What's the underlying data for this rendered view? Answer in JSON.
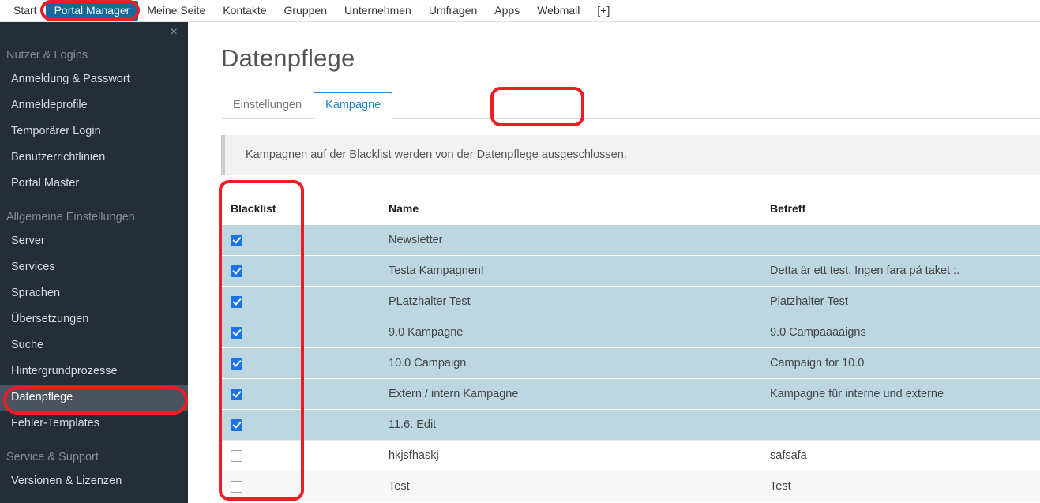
{
  "topnav": {
    "items": [
      {
        "label": "Start",
        "active": false
      },
      {
        "label": "Portal Manager",
        "active": true
      },
      {
        "label": "Meine Seite",
        "active": false
      },
      {
        "label": "Kontakte",
        "active": false
      },
      {
        "label": "Gruppen",
        "active": false
      },
      {
        "label": "Unternehmen",
        "active": false
      },
      {
        "label": "Umfragen",
        "active": false
      },
      {
        "label": "Apps",
        "active": false
      },
      {
        "label": "Webmail",
        "active": false
      },
      {
        "label": "[+]",
        "active": false
      }
    ],
    "active_accent": "#16699e"
  },
  "sidebar": {
    "close_label": "×",
    "groups": [
      {
        "title": "Nutzer & Logins",
        "items": [
          {
            "label": "Anmeldung & Passwort",
            "active": false
          },
          {
            "label": "Anmeldeprofile",
            "active": false
          },
          {
            "label": "Temporärer Login",
            "active": false
          },
          {
            "label": "Benutzerrichtlinien",
            "active": false
          },
          {
            "label": "Portal Master",
            "active": false
          }
        ]
      },
      {
        "title": "Allgemeine Einstellungen",
        "items": [
          {
            "label": "Server",
            "active": false
          },
          {
            "label": "Services",
            "active": false
          },
          {
            "label": "Sprachen",
            "active": false
          },
          {
            "label": "Übersetzungen",
            "active": false
          },
          {
            "label": "Suche",
            "active": false
          },
          {
            "label": "Hintergrundprozesse",
            "active": false
          },
          {
            "label": "Datenpflege",
            "active": true
          },
          {
            "label": "Fehler-Templates",
            "active": false
          }
        ]
      },
      {
        "title": "Service & Support",
        "items": [
          {
            "label": "Versionen & Lizenzen",
            "active": false
          }
        ]
      }
    ]
  },
  "main": {
    "page_title": "Datenpflege",
    "tabs": [
      {
        "label": "Einstellungen",
        "active": false
      },
      {
        "label": "Kampagne",
        "active": true
      }
    ],
    "info_text": "Kampagnen auf der Blacklist werden von der Datenpflege ausgeschlossen.",
    "table": {
      "columns": [
        "Blacklist",
        "Name",
        "Betreff"
      ],
      "rows": [
        {
          "checked": true,
          "name": "Newsletter",
          "betreff": ""
        },
        {
          "checked": true,
          "name": "Testa Kampagnen!",
          "betreff": "Detta är ett test. Ingen fara på taket :."
        },
        {
          "checked": true,
          "name": "PLatzhalter Test",
          "betreff": "Platzhalter Test"
        },
        {
          "checked": true,
          "name": "9.0 Kampagne",
          "betreff": "9.0 Campaaaaigns"
        },
        {
          "checked": true,
          "name": "10.0 Campaign",
          "betreff": "Campaign for 10.0"
        },
        {
          "checked": true,
          "name": "Extern / intern Kampagne",
          "betreff": "Kampagne für interne und externe"
        },
        {
          "checked": true,
          "name": "11.6. Edit",
          "betreff": ""
        },
        {
          "checked": false,
          "name": "hkjsfhaskj",
          "betreff": "safsafa"
        },
        {
          "checked": false,
          "name": "Test",
          "betreff": "Test"
        }
      ]
    }
  },
  "annotations": {
    "color": "#ee1c25",
    "targets": [
      "portal-manager-nav",
      "datenpflege-sidebar-item",
      "kampagne-tab",
      "blacklist-column"
    ]
  }
}
